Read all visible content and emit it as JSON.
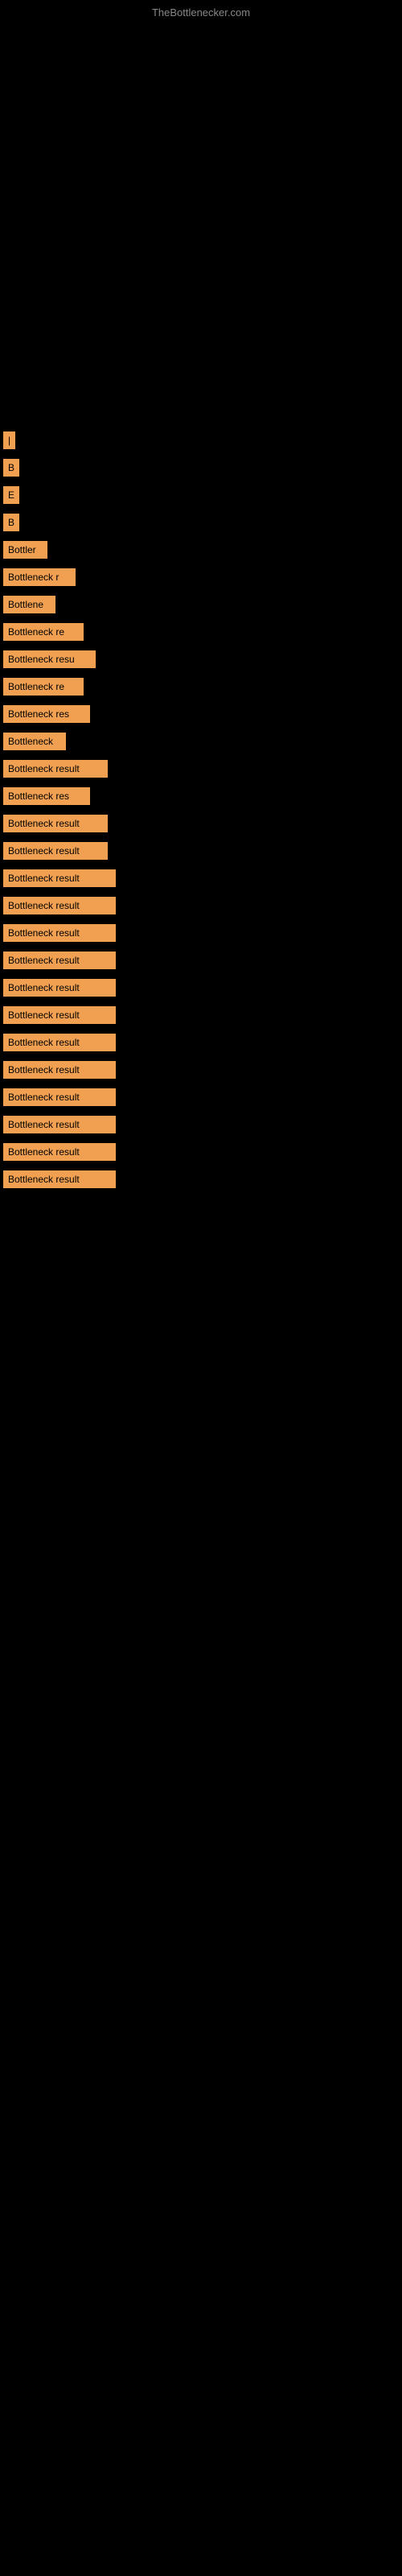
{
  "site": {
    "title": "TheBottlenecker.com"
  },
  "items": [
    {
      "id": 1,
      "label": "|",
      "width": 8
    },
    {
      "id": 2,
      "label": "B",
      "width": 18
    },
    {
      "id": 3,
      "label": "E",
      "width": 14
    },
    {
      "id": 4,
      "label": "B",
      "width": 18
    },
    {
      "id": 5,
      "label": "Bottler",
      "width": 55
    },
    {
      "id": 6,
      "label": "Bottleneck r",
      "width": 90
    },
    {
      "id": 7,
      "label": "Bottlene",
      "width": 65
    },
    {
      "id": 8,
      "label": "Bottleneck re",
      "width": 100
    },
    {
      "id": 9,
      "label": "Bottleneck resu",
      "width": 115
    },
    {
      "id": 10,
      "label": "Bottleneck re",
      "width": 100
    },
    {
      "id": 11,
      "label": "Bottleneck res",
      "width": 108
    },
    {
      "id": 12,
      "label": "Bottleneck",
      "width": 78
    },
    {
      "id": 13,
      "label": "Bottleneck result",
      "width": 130
    },
    {
      "id": 14,
      "label": "Bottleneck res",
      "width": 108
    },
    {
      "id": 15,
      "label": "Bottleneck result",
      "width": 130
    },
    {
      "id": 16,
      "label": "Bottleneck result",
      "width": 130
    },
    {
      "id": 17,
      "label": "Bottleneck result",
      "width": 140
    },
    {
      "id": 18,
      "label": "Bottleneck result",
      "width": 140
    },
    {
      "id": 19,
      "label": "Bottleneck result",
      "width": 140
    },
    {
      "id": 20,
      "label": "Bottleneck result",
      "width": 140
    },
    {
      "id": 21,
      "label": "Bottleneck result",
      "width": 140
    },
    {
      "id": 22,
      "label": "Bottleneck result",
      "width": 140
    },
    {
      "id": 23,
      "label": "Bottleneck result",
      "width": 140
    },
    {
      "id": 24,
      "label": "Bottleneck result",
      "width": 140
    },
    {
      "id": 25,
      "label": "Bottleneck result",
      "width": 140
    },
    {
      "id": 26,
      "label": "Bottleneck result",
      "width": 140
    },
    {
      "id": 27,
      "label": "Bottleneck result",
      "width": 140
    },
    {
      "id": 28,
      "label": "Bottleneck result",
      "width": 140
    }
  ]
}
